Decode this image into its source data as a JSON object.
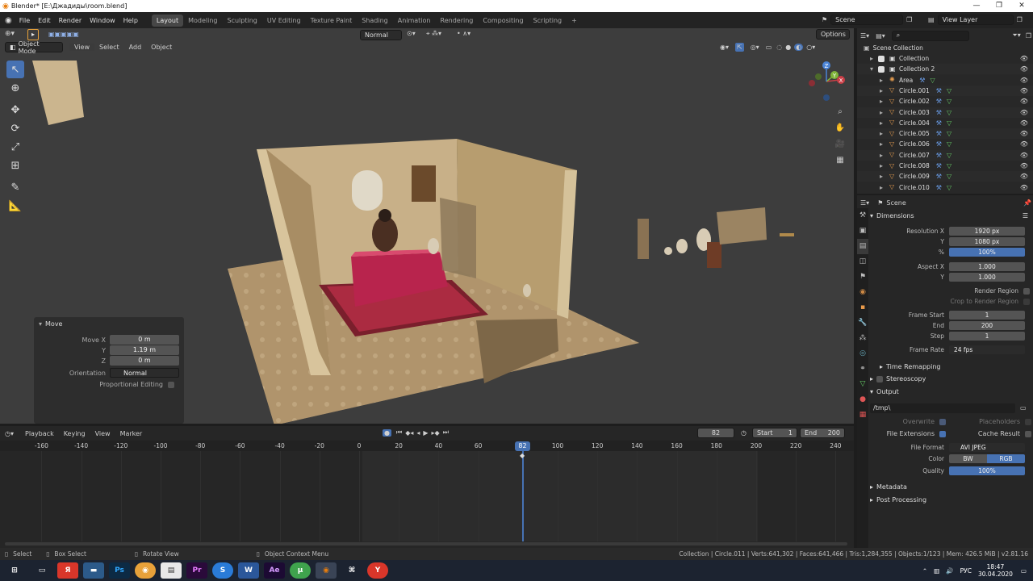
{
  "window": {
    "title": "Blender* [E:\\Джадиды\\room.blend]",
    "minimize": "—",
    "maximize": "❐",
    "close": "✕"
  },
  "menu": [
    "File",
    "Edit",
    "Render",
    "Window",
    "Help"
  ],
  "workspaces": [
    "Layout",
    "Modeling",
    "Sculpting",
    "UV Editing",
    "Texture Paint",
    "Shading",
    "Animation",
    "Rendering",
    "Compositing",
    "Scripting"
  ],
  "active_workspace": "Layout",
  "scene_selector": "Scene",
  "view_layer_selector": "View Layer",
  "viewport": {
    "mode": "Object Mode",
    "menus": [
      "View",
      "Select",
      "Add",
      "Object"
    ],
    "orientation": "Normal",
    "options": "Options",
    "gizmo": {
      "x": "X",
      "y": "Y",
      "z": "Z"
    }
  },
  "move_panel": {
    "title": "Move",
    "move_x_label": "Move X",
    "move_x": "0 m",
    "y_label": "Y",
    "y": "1.19 m",
    "z_label": "Z",
    "z": "0 m",
    "orientation_label": "Orientation",
    "orientation": "Normal",
    "proportional": "Proportional Editing"
  },
  "outliner": {
    "root": "Scene Collection",
    "items": [
      {
        "name": "Collection",
        "level": 1
      },
      {
        "name": "Collection 2",
        "level": 1
      },
      {
        "name": "Area",
        "level": 2
      },
      {
        "name": "Circle.001",
        "level": 2
      },
      {
        "name": "Circle.002",
        "level": 2
      },
      {
        "name": "Circle.003",
        "level": 2
      },
      {
        "name": "Circle.004",
        "level": 2
      },
      {
        "name": "Circle.005",
        "level": 2
      },
      {
        "name": "Circle.006",
        "level": 2
      },
      {
        "name": "Circle.007",
        "level": 2
      },
      {
        "name": "Circle.008",
        "level": 2
      },
      {
        "name": "Circle.009",
        "level": 2
      },
      {
        "name": "Circle.010",
        "level": 2
      }
    ]
  },
  "properties": {
    "context": "Scene",
    "dimensions": "Dimensions",
    "resolution_x_label": "Resolution X",
    "resolution_x": "1920 px",
    "resolution_y_label": "Y",
    "resolution_y": "1080 px",
    "percent_label": "%",
    "percent": "100%",
    "aspect_x_label": "Aspect X",
    "aspect_x": "1.000",
    "aspect_y_label": "Y",
    "aspect_y": "1.000",
    "render_region": "Render Region",
    "crop_region": "Crop to Render Region",
    "frame_start_label": "Frame Start",
    "frame_start": "1",
    "end_label": "End",
    "end": "200",
    "step_label": "Step",
    "step": "1",
    "frame_rate_label": "Frame Rate",
    "frame_rate": "24 fps",
    "time_remapping": "Time Remapping",
    "stereoscopy": "Stereoscopy",
    "output": "Output",
    "output_path": "/tmp\\",
    "overwrite": "Overwrite",
    "placeholders": "Placeholders",
    "file_extensions": "File Extensions",
    "cache_result": "Cache Result",
    "file_format_label": "File Format",
    "file_format": "AVI JPEG",
    "color_label": "Color",
    "color_bw": "BW",
    "color_rgb": "RGB",
    "quality_label": "Quality",
    "quality": "100%",
    "metadata": "Metadata",
    "post_processing": "Post Processing"
  },
  "timeline": {
    "menus": [
      "Playback",
      "Keying",
      "View",
      "Marker"
    ],
    "current_frame": "82",
    "start_label": "Start",
    "start": "1",
    "end_label": "End",
    "end": "200",
    "ticks": [
      "-160",
      "-140",
      "-120",
      "-100",
      "-80",
      "-60",
      "-40",
      "-20",
      "0",
      "20",
      "40",
      "60",
      "82",
      "100",
      "120",
      "140",
      "160",
      "180",
      "200",
      "220",
      "240"
    ]
  },
  "statusbar": {
    "select": "Select",
    "box_select": "Box Select",
    "rotate_view": "Rotate View",
    "context_menu": "Object Context Menu",
    "stats": "Collection | Circle.011 | Verts:641,302 | Faces:641,466 | Tris:1,284,355 | Objects:1/123 | Mem: 426.5 MiB | v2.81.16"
  },
  "taskbar": {
    "language": "РУС",
    "time": "18:47",
    "date": "30.04.2020"
  },
  "colors": {
    "accent": "#4772b3",
    "viewport_bg": "#3d3d3d",
    "panel_bg": "#262626"
  }
}
